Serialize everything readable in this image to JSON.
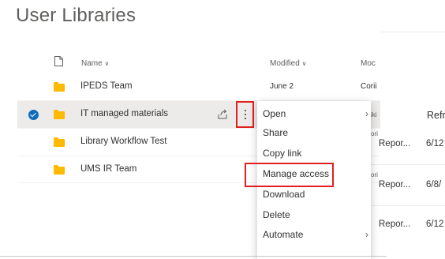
{
  "page": {
    "title": "User Libraries"
  },
  "columns": {
    "name": "Name",
    "modified": "Modified",
    "modified_by": "Moc",
    "sort_glyph": "∨"
  },
  "rows": [
    {
      "name": "IPEDS Team",
      "modified": "June 2",
      "modified_by": "Corii",
      "selected": false
    },
    {
      "name": "IT managed materials",
      "modified": "",
      "modified_by": "",
      "selected": true
    },
    {
      "name": "Library Workflow Test",
      "modified": "",
      "modified_by": "",
      "selected": false
    },
    {
      "name": "UMS IR Team",
      "modified": "",
      "modified_by": "",
      "selected": false
    }
  ],
  "context_menu": {
    "items": [
      {
        "label": "Open",
        "has_submenu": true
      },
      {
        "label": "Share",
        "has_submenu": false
      },
      {
        "label": "Copy link",
        "has_submenu": false
      },
      {
        "label": "Manage access",
        "has_submenu": false,
        "highlighted": true
      },
      {
        "label": "Download",
        "has_submenu": false
      },
      {
        "label": "Delete",
        "has_submenu": false
      },
      {
        "label": "Automate",
        "has_submenu": true
      }
    ],
    "submenu_glyph": "›"
  },
  "background_panel": {
    "header": "Refr",
    "rows": [
      {
        "prefix": "iki",
        "type": "",
        "date": ""
      },
      {
        "prefix": "ori",
        "type": "Repor...",
        "date": "6/12"
      },
      {
        "prefix": "ori",
        "type": "Repor...",
        "date": "6/8/"
      },
      {
        "prefix": "",
        "type": "Repor...",
        "date": "6/12"
      }
    ]
  },
  "colors": {
    "accent": "#0f6cbd",
    "folder": "#ffb900",
    "highlight_box": "#e02020",
    "selected_row": "#edebe9"
  },
  "icons": {
    "file_header": "document-icon",
    "folder": "folder-icon",
    "share": "share-icon",
    "more": "more-vertical-icon",
    "check": "checkmark-circle-icon"
  }
}
